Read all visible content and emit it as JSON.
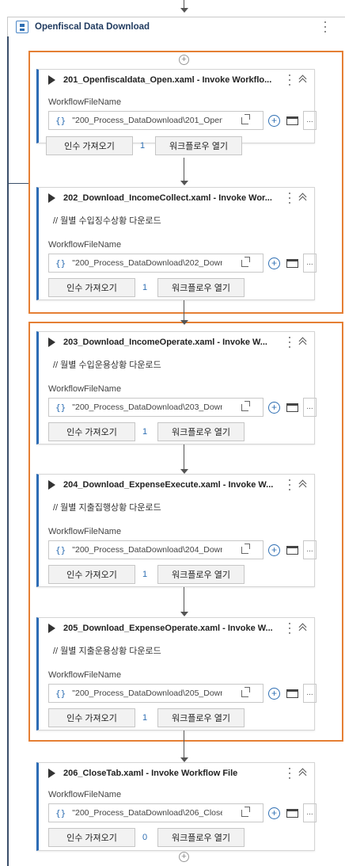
{
  "sequence": {
    "title": "Openfiscal Data Download"
  },
  "field_label": "WorkflowFileName",
  "buttons": {
    "import_args": "인수 가져오기",
    "open_workflow": "워크플로우 열기"
  },
  "cards": [
    {
      "title": "201_Openfiscaldata_Open.xaml - Invoke Workflo...",
      "comment": "",
      "path": "\"200_Process_DataDownload\\201_Open",
      "arg_count": "1"
    },
    {
      "title": "202_Download_IncomeCollect.xaml - Invoke Wor...",
      "comment": "// 월별 수입징수상황 다운로드",
      "path": "\"200_Process_DataDownload\\202_Down",
      "arg_count": "1"
    },
    {
      "title": "203_Download_IncomeOperate.xaml - Invoke W...",
      "comment": "// 월별 수입운용상황 다운로드",
      "path": "\"200_Process_DataDownload\\203_Down",
      "arg_count": "1"
    },
    {
      "title": "204_Download_ExpenseExecute.xaml - Invoke W...",
      "comment": "// 월별 지출집행상황 다운로드",
      "path": "\"200_Process_DataDownload\\204_Down",
      "arg_count": "1"
    },
    {
      "title": "205_Download_ExpenseOperate.xaml - Invoke W...",
      "comment": "// 월별 지출운용상황 다운로드",
      "path": "\"200_Process_DataDownload\\205_Down",
      "arg_count": "1"
    },
    {
      "title": "206_CloseTab.xaml - Invoke Workflow File",
      "comment": "",
      "path": "\"200_Process_DataDownload\\206_Close",
      "arg_count": "0"
    }
  ],
  "colors": {
    "highlight": "#e57f34",
    "accent": "#2d6cb5"
  }
}
